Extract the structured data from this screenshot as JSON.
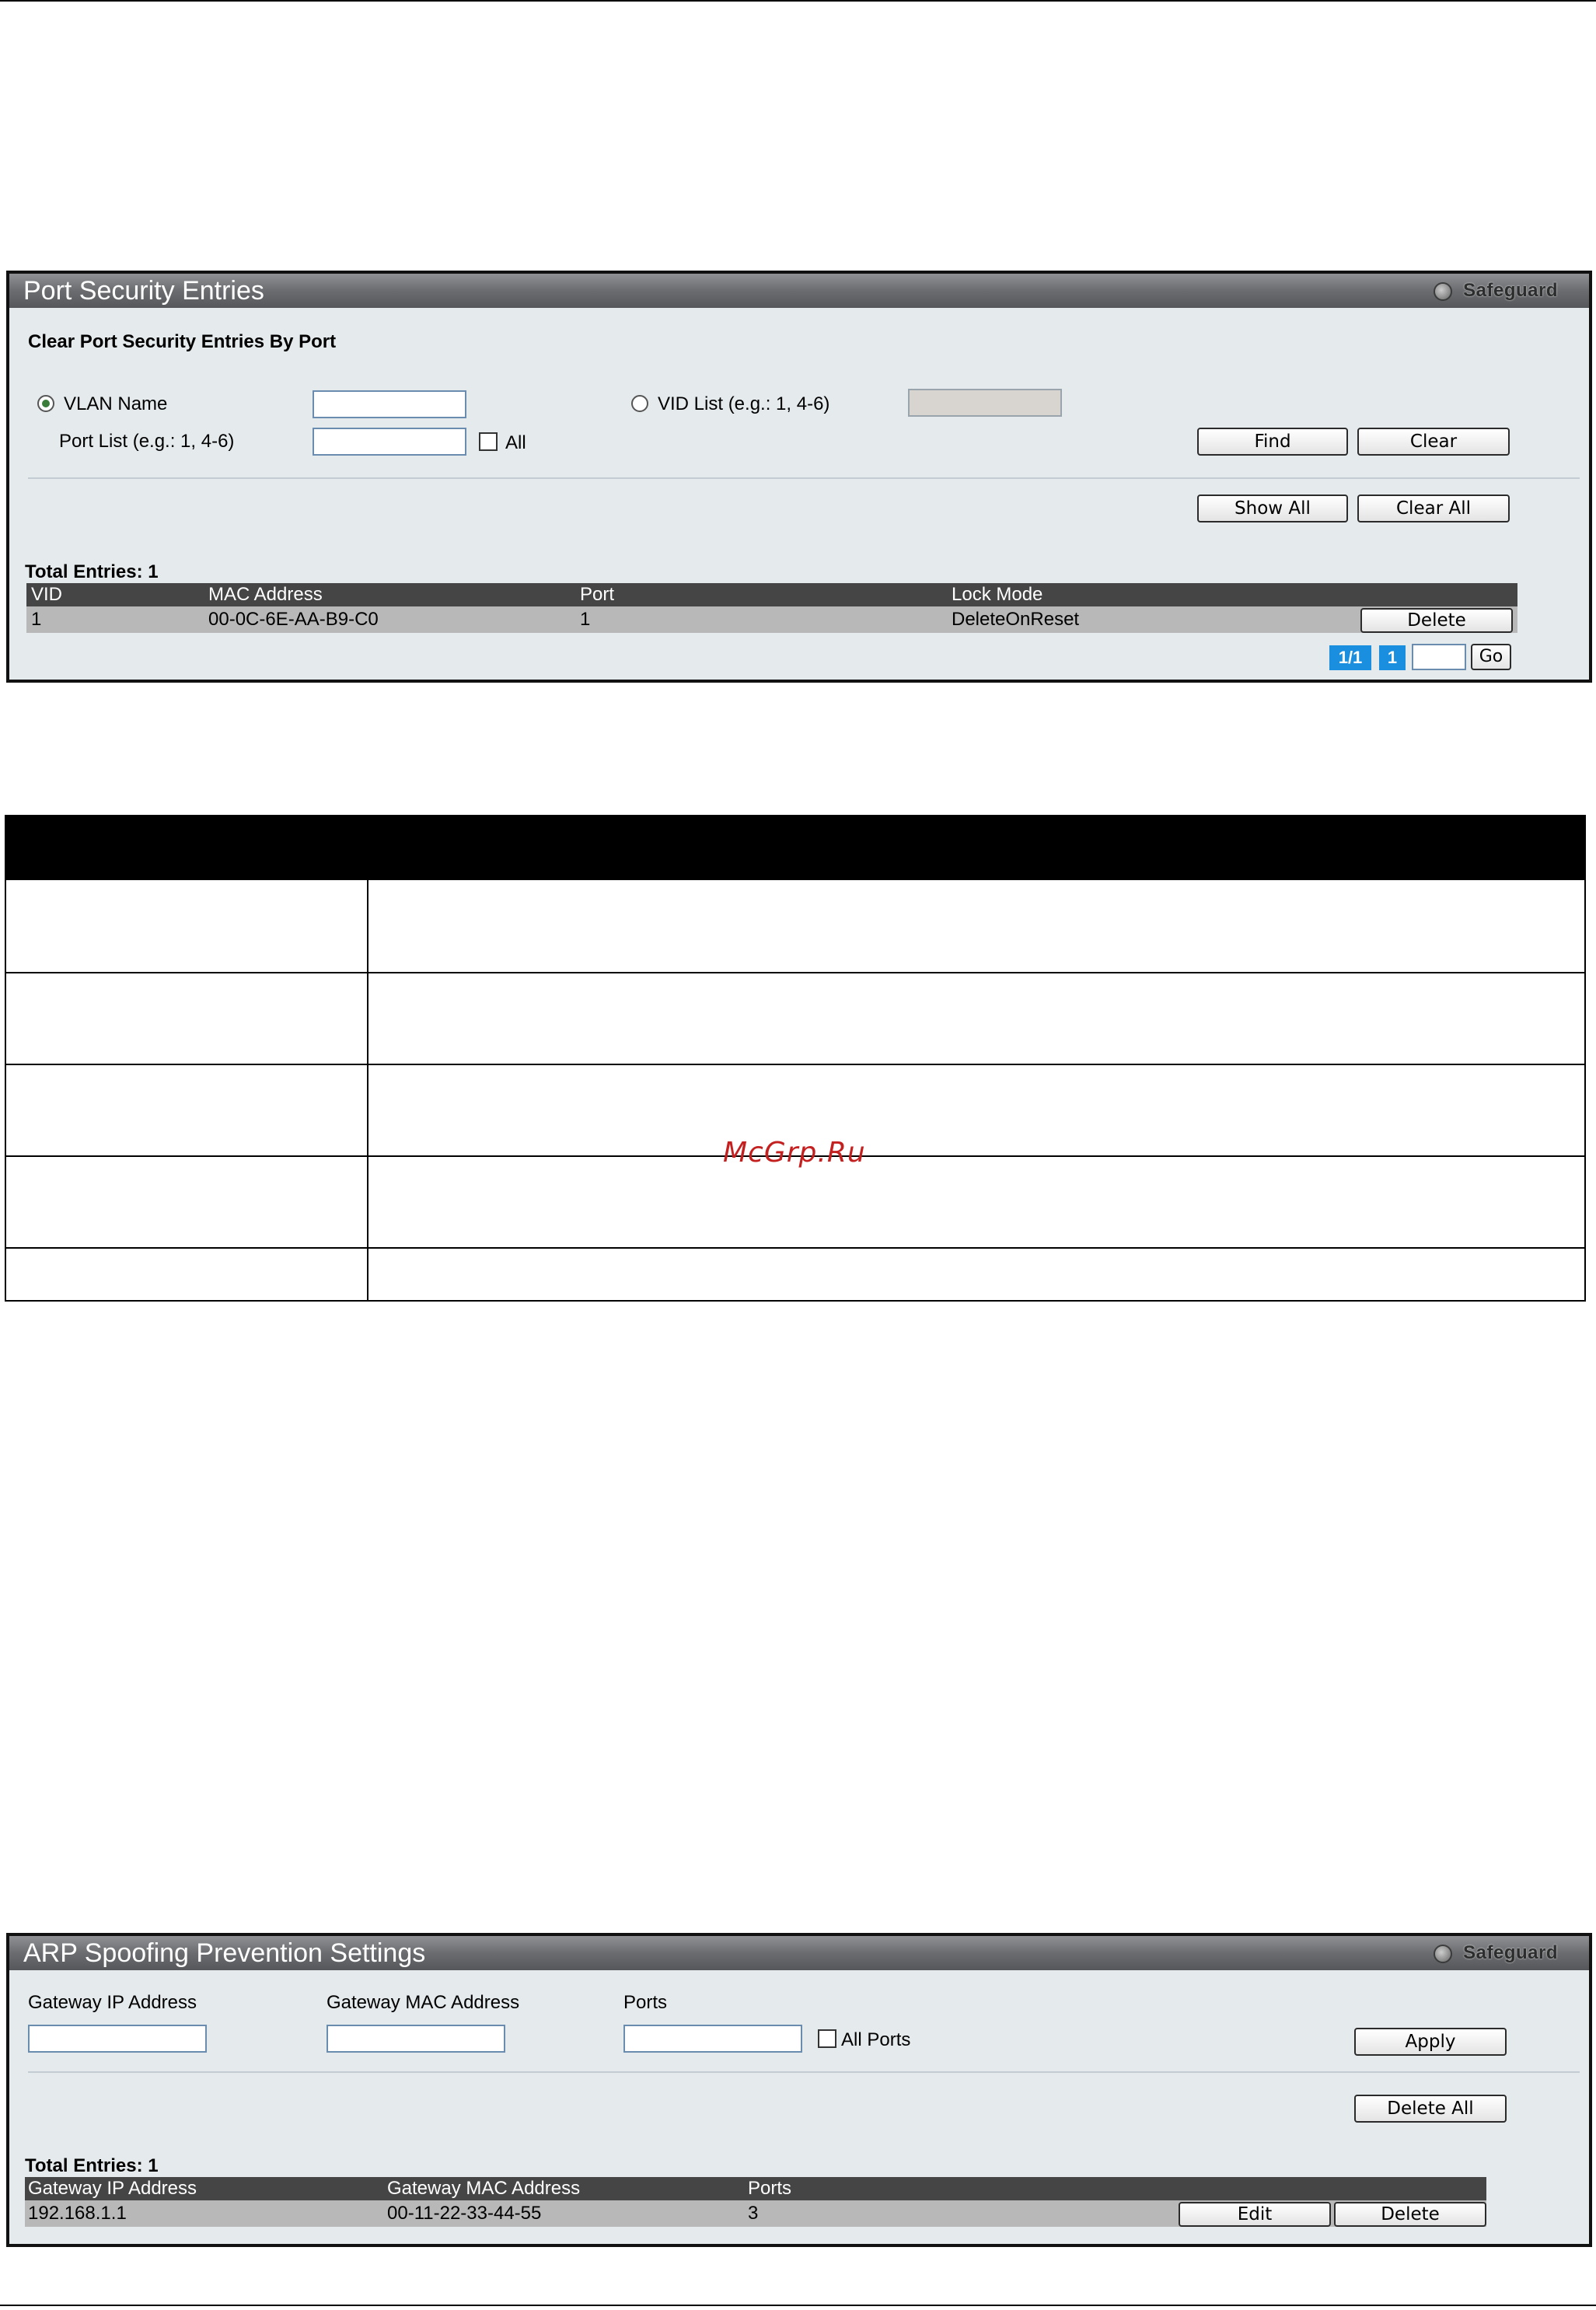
{
  "port_security": {
    "title": "Port Security Entries",
    "safeguard": "Safeguard",
    "section_title": "Clear Port Security Entries By Port",
    "vlan_name_label": "VLAN Name",
    "vid_list_label": "VID List (e.g.: 1, 4-6)",
    "port_list_label": "Port List (e.g.: 1, 4-6)",
    "all_label": "All",
    "vlan_name_value": "",
    "vid_list_value": "",
    "port_list_value": "",
    "find_label": "Find",
    "clear_label": "Clear",
    "show_all_label": "Show All",
    "clear_all_label": "Clear All",
    "total_entries": "Total Entries: 1",
    "columns": [
      "VID",
      "MAC Address",
      "Port",
      "Lock Mode"
    ],
    "rows": [
      {
        "vid": "1",
        "mac": "00-0C-6E-AA-B9-C0",
        "port": "1",
        "lock_mode": "DeleteOnReset",
        "delete_label": "Delete"
      }
    ],
    "pager": {
      "pages": "1/1",
      "current": "1",
      "go_label": "Go",
      "goto_value": ""
    }
  },
  "watermark": "McGrp.Ru",
  "arp_spoofing": {
    "title": "ARP Spoofing Prevention Settings",
    "safeguard": "Safeguard",
    "gateway_ip_label": "Gateway IP Address",
    "gateway_mac_label": "Gateway MAC Address",
    "ports_label": "Ports",
    "all_ports_label": "All Ports",
    "gateway_ip_value": "",
    "gateway_mac_value": "",
    "ports_value": "",
    "apply_label": "Apply",
    "delete_all_label": "Delete All",
    "total_entries": "Total Entries: 1",
    "columns": [
      "Gateway IP Address",
      "Gateway MAC Address",
      "Ports"
    ],
    "rows": [
      {
        "ip": "192.168.1.1",
        "mac": "00-11-22-33-44-55",
        "ports": "3",
        "edit_label": "Edit",
        "delete_label": "Delete"
      }
    ]
  }
}
